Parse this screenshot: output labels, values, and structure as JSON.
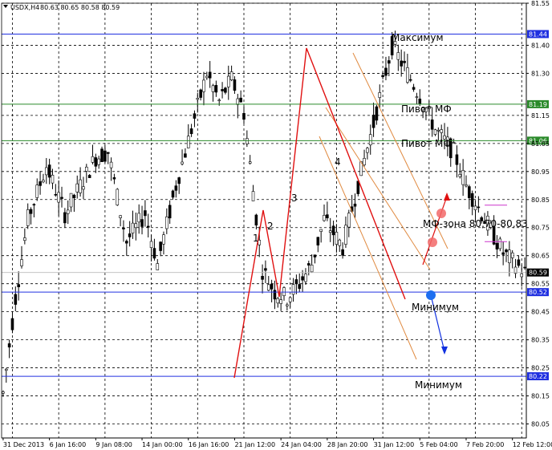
{
  "chart_data": {
    "type": "candlestick",
    "header": {
      "symbol": "USDX,H4",
      "ohlc": "80.63 80.65 80.58 80.59"
    },
    "ylim": [
      80.0,
      81.55
    ],
    "y_ticks": [
      "81.55",
      "81.40",
      "81.30",
      "81.15",
      "81.05",
      "80.95",
      "80.85",
      "80.75",
      "80.65",
      "80.55",
      "80.45",
      "80.35",
      "80.25",
      "80.15",
      "80.05"
    ],
    "y_tick_values": [
      81.55,
      81.4,
      81.3,
      81.15,
      81.05,
      80.95,
      80.85,
      80.75,
      80.65,
      80.55,
      80.45,
      80.35,
      80.25,
      80.15,
      80.05
    ],
    "x_ticks": [
      "31 Dec 2013",
      "6 Jan 16:00",
      "9 Jan 08:00",
      "14 Jan 00:00",
      "16 Jan 16:00",
      "21 Jan 12:00",
      "24 Jan 04:00",
      "28 Jan 20:00",
      "31 Jan 12:00",
      "5 Feb 04:00",
      "7 Feb 20:00",
      "12 Feb 12:00"
    ],
    "x_tick_index": [
      0,
      15,
      30,
      45,
      60,
      75,
      90,
      105,
      120,
      135,
      150,
      165
    ],
    "bar_count": 170,
    "price_label_current": "80.59",
    "current_price": 80.59,
    "levels": [
      {
        "value": 81.44,
        "label": "81.44",
        "color": "#2030e0",
        "annotation": "Максимум"
      },
      {
        "value": 81.19,
        "label": "81.19",
        "color": "#2a8a2a",
        "annotation": "Пивот МФ"
      },
      {
        "value": 81.06,
        "label": "81.06",
        "color": "#2a8a2a",
        "annotation": "Пивот МФ"
      },
      {
        "value": 80.52,
        "label": "80.52",
        "color": "#2030e0",
        "annotation": "Минимум"
      },
      {
        "value": 80.22,
        "label": "80.22",
        "color": "#2030e0",
        "annotation": "Минимум"
      }
    ],
    "zone": {
      "low": 80.7,
      "high": 80.83,
      "annotation": "МФ-зона 80,70-80,83",
      "color": "#cc33cc"
    },
    "wave_labels": [
      "1",
      "2",
      "3",
      "4"
    ],
    "colors": {
      "background": "#ffffff",
      "candle": "#000000",
      "grid": "#000000",
      "wave": "#e01010",
      "channel": "#e08a40",
      "up_arrow": "#e01010",
      "down_arrow": "#1030e0"
    }
  }
}
